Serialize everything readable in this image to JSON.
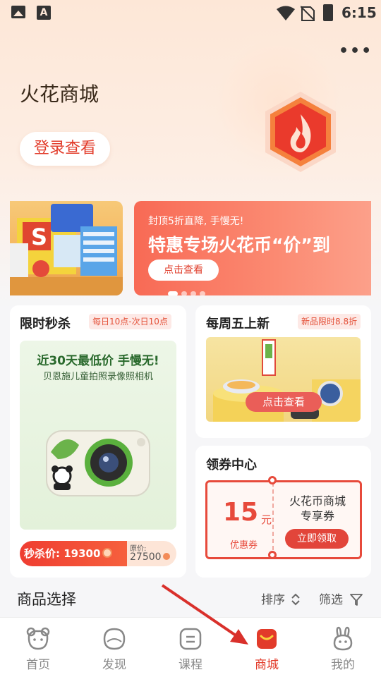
{
  "status_bar": {
    "time": "6:15",
    "a_icon": "A"
  },
  "header": {
    "title": "火花商城",
    "login_button": "登录查看",
    "more_label": "•••"
  },
  "banner": {
    "subtitle": "封顶5折直降, 手慢无!",
    "title": "特惠专场火花币“价”到",
    "button": "点击查看",
    "dot_count": 4,
    "active_dot": 1
  },
  "flash_sale": {
    "title": "限时秒杀",
    "tag": "每日10点-次日10点",
    "promo_headline": "近30天最低价 手慢无!",
    "product_name": "贝恩施儿童拍照录像照相机",
    "price_label": "秒杀价: 19300",
    "original_label": "原价:",
    "original_price": "27500"
  },
  "new_arrivals": {
    "title": "每周五上新",
    "tag": "新品限时8.8折",
    "button": "点击查看"
  },
  "coupon_center": {
    "title": "领券中心",
    "amount": "15",
    "unit": "元",
    "type": "优惠券",
    "line1": "火花币商城",
    "line2": "专享券",
    "button": "立即领取"
  },
  "product_select": {
    "title": "商品选择",
    "sort": "排序",
    "filter": "筛选"
  },
  "nav": [
    {
      "label": "首页",
      "icon": "bear-face-icon"
    },
    {
      "label": "发现",
      "icon": "discover-icon"
    },
    {
      "label": "课程",
      "icon": "course-icon"
    },
    {
      "label": "商城",
      "icon": "mall-icon",
      "active": true
    },
    {
      "label": "我的",
      "icon": "bunny-icon"
    }
  ],
  "colors": {
    "accent": "#e23b2a",
    "banner": "#f86a55",
    "coupon": "#e74a3b"
  }
}
